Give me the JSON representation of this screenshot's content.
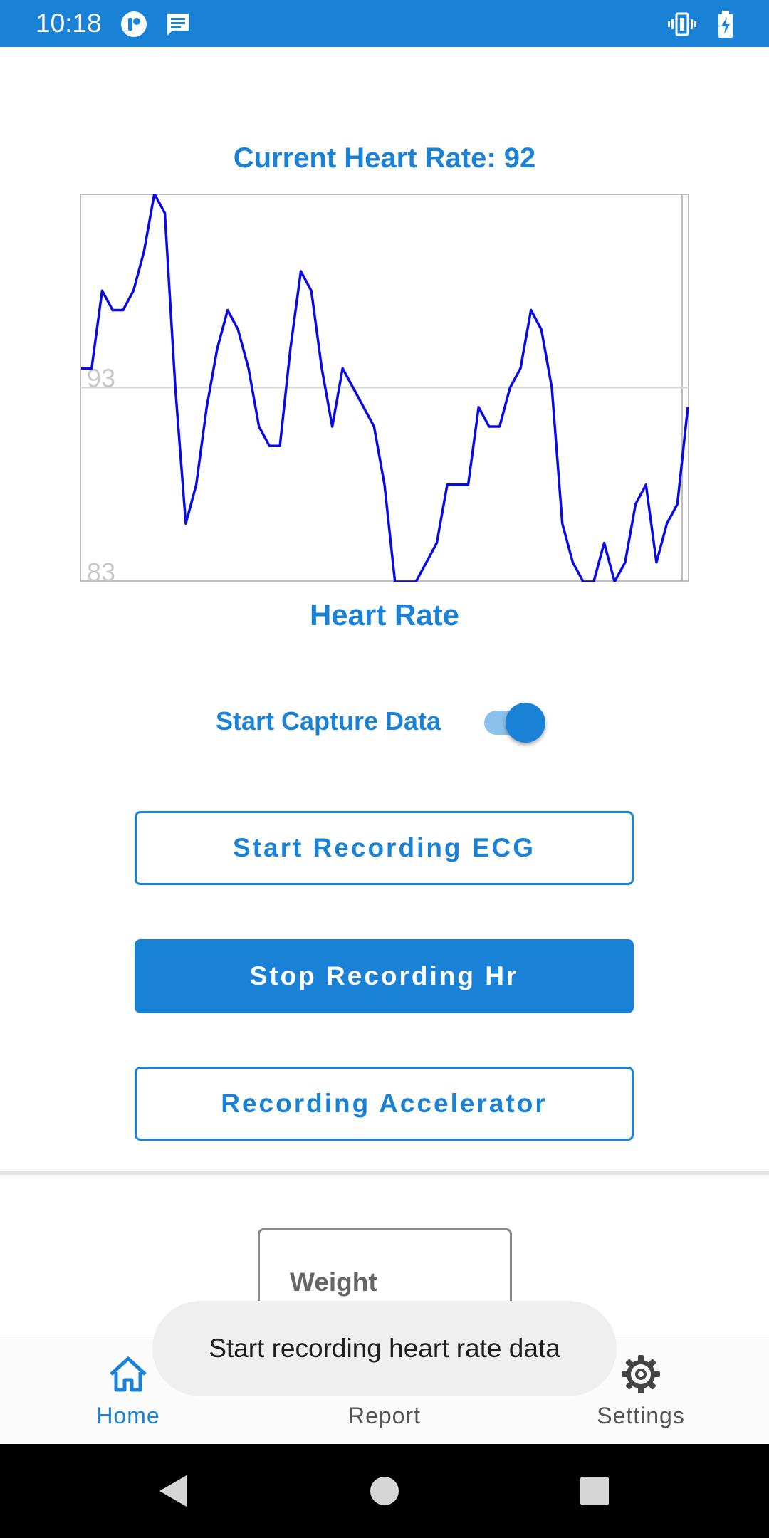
{
  "status_bar": {
    "time": "10:18",
    "icons": [
      "app-notification-icon",
      "message-icon",
      "vibrate-icon",
      "battery-charging-icon"
    ]
  },
  "heart_rate": {
    "title": "Current Heart Rate: 92",
    "caption": "Heart Rate"
  },
  "chart_data": {
    "type": "line",
    "title": "Current Heart Rate: 92",
    "xlabel": "Heart Rate",
    "ylabel": "",
    "ylim": [
      83,
      103
    ],
    "y_ticks": [
      "93",
      "83"
    ],
    "grid": true,
    "line_color": "#0a0ae6",
    "series": [
      {
        "values": [
          94,
          94,
          98,
          97,
          97,
          98,
          100,
          103,
          102,
          93,
          86,
          88,
          92,
          95,
          97,
          96,
          94,
          91,
          90,
          90,
          95,
          99,
          98,
          94,
          91,
          94,
          93,
          92,
          91,
          88,
          83,
          83,
          83,
          84,
          85,
          88,
          88,
          88,
          92,
          91,
          91,
          93,
          94,
          97,
          96,
          93,
          86,
          84,
          83,
          83,
          85,
          83,
          84,
          87,
          88,
          84,
          86,
          87,
          92
        ]
      }
    ]
  },
  "capture": {
    "label": "Start Capture Data",
    "enabled": true
  },
  "buttons": {
    "ecg": "Start Recording ECG",
    "hr": "Stop Recording Hr",
    "accel": "Recording Accelerator"
  },
  "weight": {
    "label": "Weight"
  },
  "toast": {
    "message": "Start recording heart rate data"
  },
  "bottom_nav": {
    "items": [
      {
        "label": "Home",
        "icon": "home-icon",
        "active": true
      },
      {
        "label": "Report",
        "icon": "bar-chart-icon",
        "active": false
      },
      {
        "label": "Settings",
        "icon": "gear-icon",
        "active": false
      }
    ]
  },
  "colors": {
    "accent": "#1a82d6",
    "inactive": "#555555",
    "line": "#0a0ae6"
  }
}
